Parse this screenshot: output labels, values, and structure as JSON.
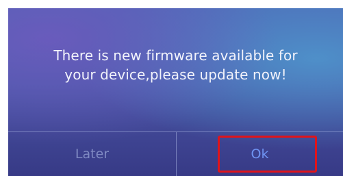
{
  "dialog": {
    "message_line1": "There is new firmware available for",
    "message_line2": "your device,please update now!",
    "later_label": "Later",
    "ok_label": "Ok"
  },
  "colors": {
    "background_top": "#4d66b5",
    "background_bottom": "#373a86",
    "message_text": "#f2f3fb",
    "later_text": "#8c96cd",
    "ok_text": "#6f93f2",
    "highlight_border": "#e0141b"
  }
}
